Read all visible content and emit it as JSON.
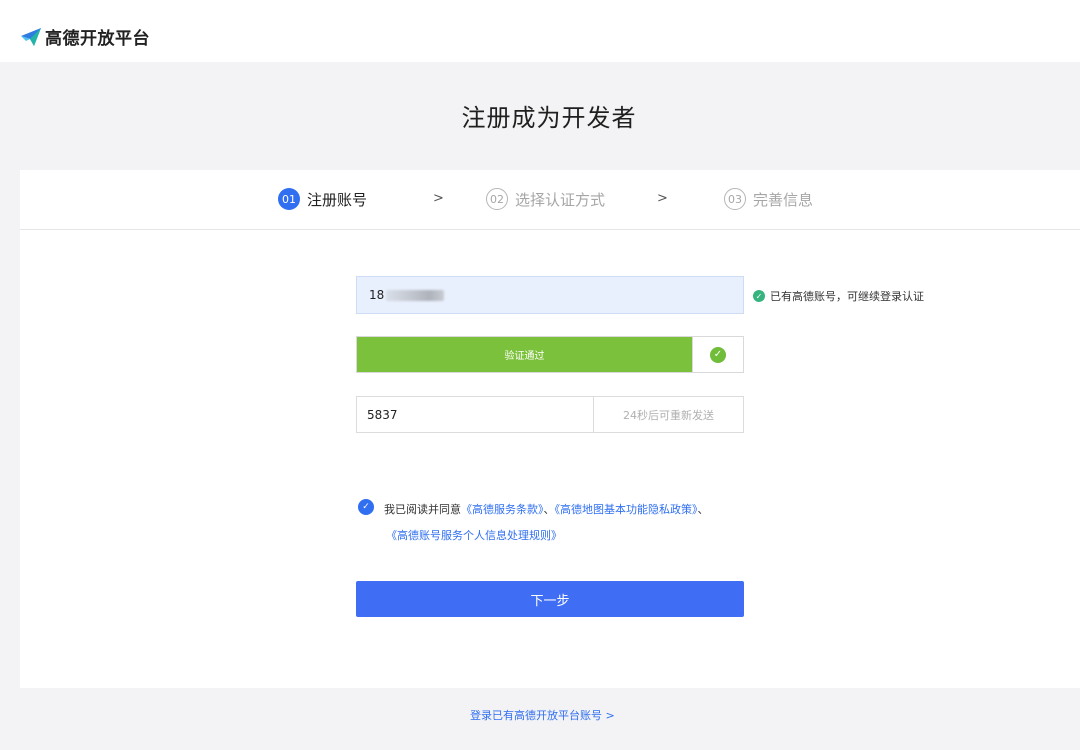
{
  "header": {
    "brand": "高德开放平台",
    "logo_icon": "paper-plane-logo-icon"
  },
  "page": {
    "title": "注册成为开发者"
  },
  "steps": [
    {
      "num": "01",
      "label": "注册账号",
      "state": "active"
    },
    {
      "num": "02",
      "label": "选择认证方式",
      "state": "inactive"
    },
    {
      "num": "03",
      "label": "完善信息",
      "state": "inactive"
    }
  ],
  "step_separator": ">",
  "form": {
    "phone_prefix": "18",
    "account_hint": "已有高德账号，可继续登录认证",
    "verify_label": "验证通过",
    "code_value": "5837",
    "resend_label": "24秒后可重新发送",
    "agreement": {
      "prefix": "我已阅读并同意",
      "link1": "《高德服务条款》",
      "sep1": "、",
      "link2": "《高德地图基本功能隐私政策》",
      "sep2": "、",
      "link3": "《高德账号服务个人信息处理规则》"
    },
    "next_label": "下一步"
  },
  "footer": {
    "login_link": "登录已有高德开放平台账号 >"
  },
  "colors": {
    "primary": "#2f6ff0",
    "success_green": "#7cc13c",
    "hint_green": "#36b37e"
  }
}
